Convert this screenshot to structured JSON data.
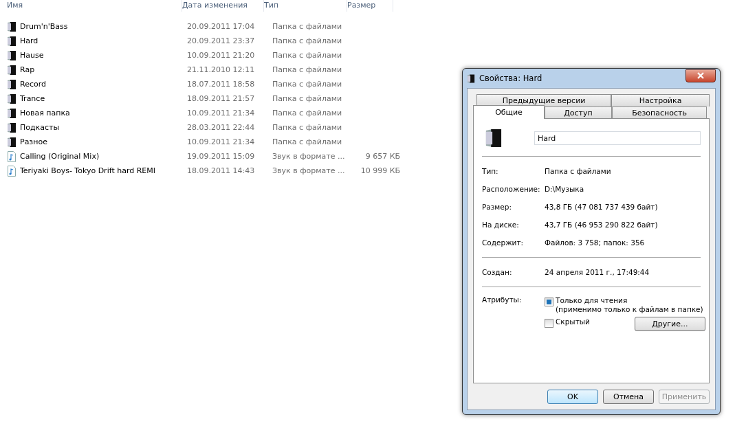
{
  "file_list": {
    "columns": [
      "Имя",
      "Дата изменения",
      "Тип",
      "Размер"
    ],
    "rows": [
      {
        "kind": "folder",
        "name": "Drum'n'Bass",
        "date": "20.09.2011 17:04",
        "type": "Папка с файлами"
      },
      {
        "kind": "folder",
        "name": "Hard",
        "date": "20.09.2011 23:37",
        "type": "Папка с файлами"
      },
      {
        "kind": "folder",
        "name": "Hause",
        "date": "10.09.2011 21:20",
        "type": "Папка с файлами"
      },
      {
        "kind": "folder",
        "name": "Rap",
        "date": "21.11.2010 12:11",
        "type": "Папка с файлами"
      },
      {
        "kind": "folder",
        "name": "Record",
        "date": "18.07.2011 18:58",
        "type": "Папка с файлами"
      },
      {
        "kind": "folder",
        "name": "Trance",
        "date": "18.09.2011 21:57",
        "type": "Папка с файлами"
      },
      {
        "kind": "folder",
        "name": "Новая папка",
        "date": "10.09.2011 21:34",
        "type": "Папка с файлами"
      },
      {
        "kind": "folder",
        "name": "Подкасты",
        "date": "28.03.2011 22:44",
        "type": "Папка с файлами"
      },
      {
        "kind": "folder",
        "name": "Разное",
        "date": "10.09.2011 21:34",
        "type": "Папка с файлами"
      },
      {
        "kind": "audio",
        "name": "Calling (Original Mix)",
        "date": "19.09.2011 15:09",
        "type": "Звук в формате ...",
        "size": "9 657 КБ"
      },
      {
        "kind": "audio",
        "name": "Teriyaki Boys- Tokyo Drift hard REMI",
        "date": "18.09.2011 14:43",
        "type": "Звук в формате ...",
        "size": "10 999 КБ"
      }
    ]
  },
  "dialog": {
    "title": "Свойства: Hard",
    "tab_rows": [
      [
        {
          "label": "Предыдущие версии",
          "selected": false
        },
        {
          "label": "Настройка",
          "selected": false
        }
      ],
      [
        {
          "label": "Общие",
          "selected": true
        },
        {
          "label": "Доступ",
          "selected": false
        },
        {
          "label": "Безопасность",
          "selected": false
        }
      ]
    ],
    "name_field": {
      "value": "Hard"
    },
    "groups": [
      [
        {
          "label": "Тип:",
          "value": "Папка с файлами"
        },
        {
          "label": "Расположение:",
          "value": "D:\\Музыка"
        },
        {
          "label": "Размер:",
          "value": "43,8 ГБ (47 081 737 439 байт)"
        },
        {
          "label": "На диске:",
          "value": "43,7 ГБ (46 953 290 822 байт)"
        },
        {
          "label": "Содержит:",
          "value": "Файлов: 3 758; папок: 356"
        }
      ],
      [
        {
          "label": "Создан:",
          "value": "24 апреля 2011 г., 17:49:44"
        }
      ]
    ],
    "attributes": {
      "label": "Атрибуты:",
      "checkboxes": [
        {
          "label": "Только для чтения",
          "note": "(применимо только к файлам в папке)",
          "checked": false,
          "indeterminate": true
        },
        {
          "label": "Скрытый",
          "checked": false,
          "indeterminate": false
        }
      ],
      "other_button": "Другие..."
    },
    "buttons": [
      {
        "label": "OK",
        "kind": "default",
        "disabled": false
      },
      {
        "label": "Отмена",
        "kind": "normal",
        "disabled": false
      },
      {
        "label": "Применить",
        "kind": "normal",
        "disabled": true
      }
    ]
  }
}
